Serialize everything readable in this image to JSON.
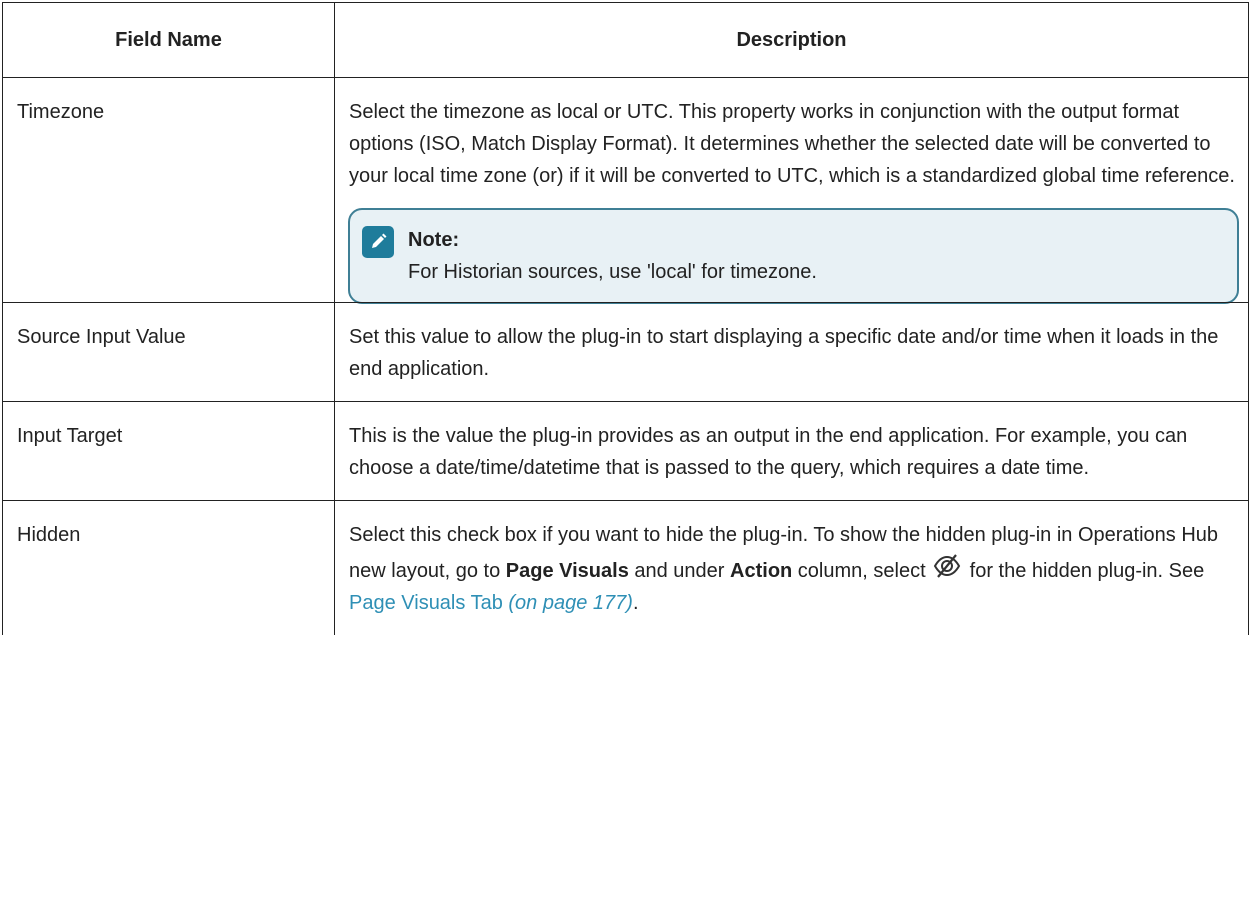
{
  "table": {
    "headers": [
      "Field Name",
      "Description"
    ],
    "rows": [
      {
        "field": "Timezone",
        "description": "Select the timezone as local or UTC. This property works in conjunction with the output format options (ISO, Match Display Format). It determines whether the selected date will be converted to your local time zone (or) if it will be converted to UTC, which is a standardized global time reference.",
        "note": {
          "icon": "pencil-note-icon",
          "title": "Note:",
          "text": "For Historian sources, use 'local' for timezone."
        }
      },
      {
        "field": "Source Input Value",
        "description": "Set this value to allow the plug-in to start displaying a specific date and/or time when it loads in the end application."
      },
      {
        "field": "Input Target",
        "description": "This is the value the plug-in provides as an output in the end application. For example, you can choose a date/time/datetime that is passed to the query, which requires a date time."
      },
      {
        "field": "Hidden",
        "description_parts": {
          "p1": "Select this check box if you want to hide the plug-in. To show the hidden plug-in in Operations Hub new layout, go to ",
          "bold1": "Page Visuals",
          "p2": " and under ",
          "bold2": "Action",
          "p3": " column, select",
          "icon": "eye-slash-icon",
          "p4": "for the hidden plug-in. See ",
          "link_text": "Page Visuals Tab",
          "link_page": "(on page 177)",
          "p5": "."
        }
      }
    ]
  },
  "colors": {
    "link": "#2e8fb5",
    "note_border": "#3f7f95",
    "note_bg": "#e8f1f5",
    "note_icon": "#1f7c9b"
  }
}
